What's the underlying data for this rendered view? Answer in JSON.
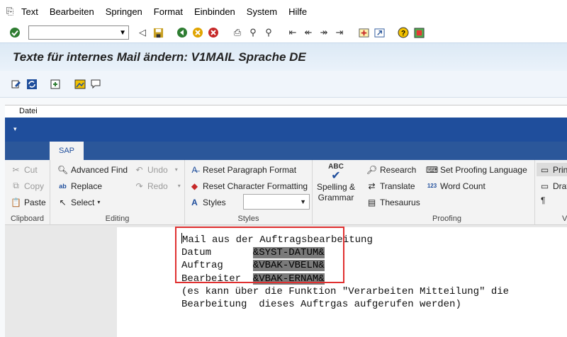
{
  "menubar": {
    "items": [
      {
        "label": "Text",
        "mnemonic": "T"
      },
      {
        "label": "Bearbeiten",
        "mnemonic": "B"
      },
      {
        "label": "Springen",
        "mnemonic": "S"
      },
      {
        "label": "Format",
        "mnemonic": "F"
      },
      {
        "label": "Einbinden",
        "mnemonic": "E"
      },
      {
        "label": "System",
        "mnemonic": "y"
      },
      {
        "label": "Hilfe",
        "mnemonic": "H"
      }
    ]
  },
  "system_toolbar": {
    "command_field_value": ""
  },
  "title": "Texte für internes Mail ändern: V1MAIL Sprache DE",
  "editor": {
    "datei_label": "Datei",
    "tab_label": "SAP",
    "ribbon": {
      "clipboard": {
        "label": "Clipboard",
        "cut": "Cut",
        "copy": "Copy",
        "paste": "Paste"
      },
      "editing": {
        "label": "Editing",
        "advanced_find": "Advanced Find",
        "replace": "Replace",
        "select": "Select",
        "undo": "Undo",
        "redo": "Redo"
      },
      "styles": {
        "label": "Styles",
        "reset_paragraph": "Reset Paragraph Format",
        "reset_character": "Reset Character Formatting",
        "styles": "Styles",
        "style_value": ""
      },
      "spelling": {
        "icon_text": "ABC",
        "line1": "Spelling &",
        "line2": "Grammar"
      },
      "proofing": {
        "label": "Proofing",
        "research": "Research",
        "translate": "Translate",
        "thesaurus": "Thesaurus",
        "set_proofing_language": "Set Proofing Language",
        "word_count": "Word Count"
      },
      "paragraph": {
        "print": "Prin",
        "draft": "Draf",
        "pilcrow": "¶",
        "label": "V"
      }
    },
    "document_lines": [
      {
        "plain": "Mail aus der Auftragsbearbeitung",
        "var": ""
      },
      {
        "plain": "Datum       ",
        "var": "&SYST-DATUM&"
      },
      {
        "plain": "Auftrag     ",
        "var": "&VBAK-VBELN&"
      },
      {
        "plain": "Bearbeiter  ",
        "var": "&VBAK-ERNAM&"
      },
      {
        "plain": "(es kann über die Funktion \"Verarbeiten Mitteilung\" die",
        "var": ""
      },
      {
        "plain": "Bearbeitung  dieses Auftrgas aufgerufen werden)",
        "var": ""
      }
    ]
  },
  "colors": {
    "title_bg": "#dce9f5",
    "ribbon_blue": "#2b579a",
    "highlight_box": "#e03030"
  }
}
